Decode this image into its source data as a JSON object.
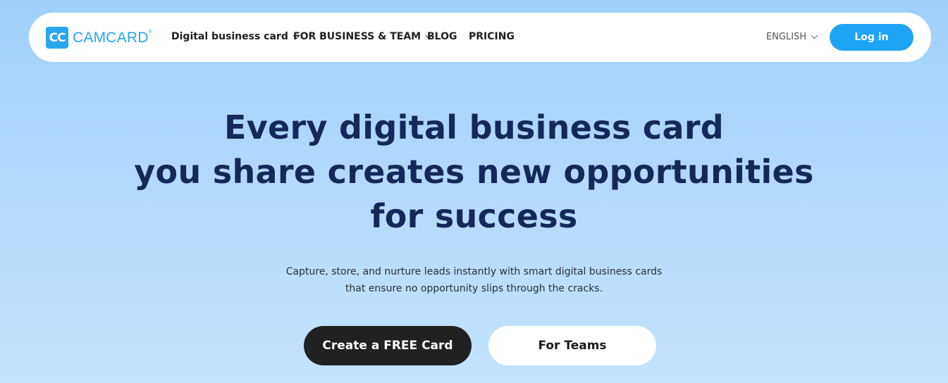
{
  "header": {
    "logo_mark": "CC",
    "logo_text": "CAMCARD",
    "logo_reg": "®",
    "nav": {
      "digital_card": "Digital business card",
      "business_team": "FOR BUSINESS & TEAM",
      "blog": "BLOG",
      "pricing": "PRICING"
    },
    "language": "ENGLISH",
    "login": "Log in"
  },
  "hero": {
    "title_lines": [
      "Every digital business card",
      "you share creates new opportunities",
      "for success"
    ],
    "subtitle_lines": [
      "Capture, store, and nurture leads instantly with smart digital business cards",
      "that ensure no opportunity slips through the cracks."
    ],
    "cta_primary": "Create a FREE Card",
    "cta_secondary": "For Teams"
  },
  "colors": {
    "brand": "#29a6f0",
    "login_button": "#1ea4f5",
    "headline": "#15285a",
    "primary_button": "#212121"
  }
}
